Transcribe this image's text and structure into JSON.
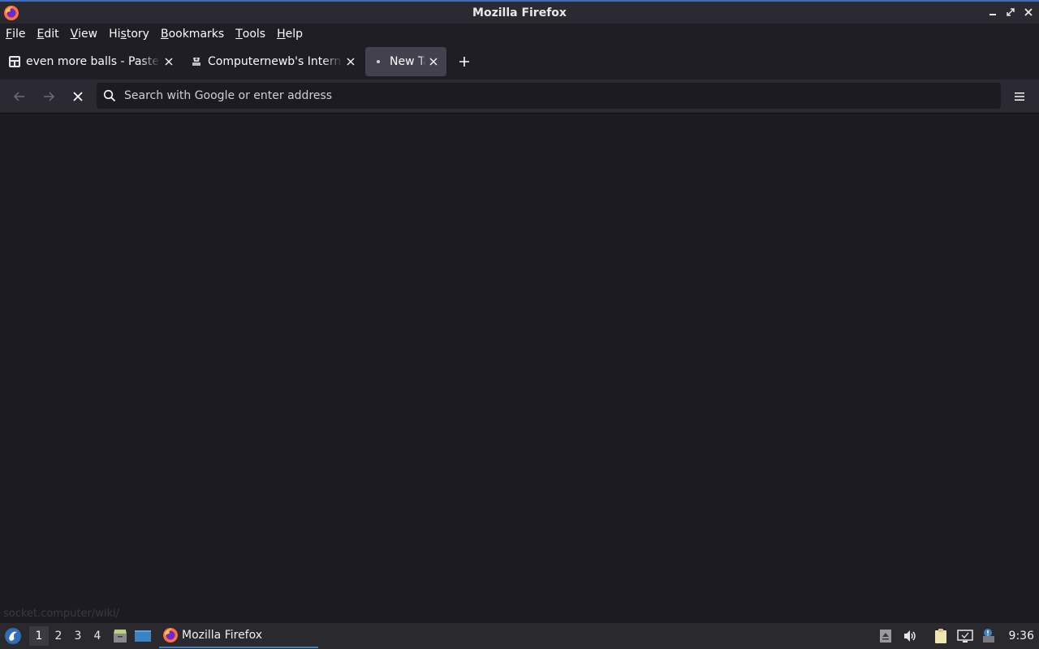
{
  "window": {
    "title": "Mozilla Firefox"
  },
  "menubar": {
    "items": [
      {
        "pre": "",
        "ul": "F",
        "post": "ile"
      },
      {
        "pre": "",
        "ul": "E",
        "post": "dit"
      },
      {
        "pre": "",
        "ul": "V",
        "post": "iew"
      },
      {
        "pre": "Hi",
        "ul": "s",
        "post": "tory"
      },
      {
        "pre": "",
        "ul": "B",
        "post": "ookmarks"
      },
      {
        "pre": "",
        "ul": "T",
        "post": "ools"
      },
      {
        "pre": "",
        "ul": "H",
        "post": "elp"
      }
    ]
  },
  "tabs": [
    {
      "label": "even more balls - Pastebin.com",
      "active": false
    },
    {
      "label": "Computernewb's Internet Wiki",
      "active": false
    },
    {
      "label": "New Tab",
      "active": true
    }
  ],
  "navbar": {
    "url_placeholder": "Search with Google or enter address",
    "url_value": ""
  },
  "content": {
    "status_text": "socket.computer/wiki/"
  },
  "taskbar": {
    "workspaces": [
      "1",
      "2",
      "3",
      "4"
    ],
    "active_workspace": "1",
    "task_label": "Mozilla Firefox",
    "clock": "9:36"
  },
  "colors": {
    "accent": "#3d82c4",
    "background": "#1c1b22",
    "toolbar": "#2b2a33"
  }
}
